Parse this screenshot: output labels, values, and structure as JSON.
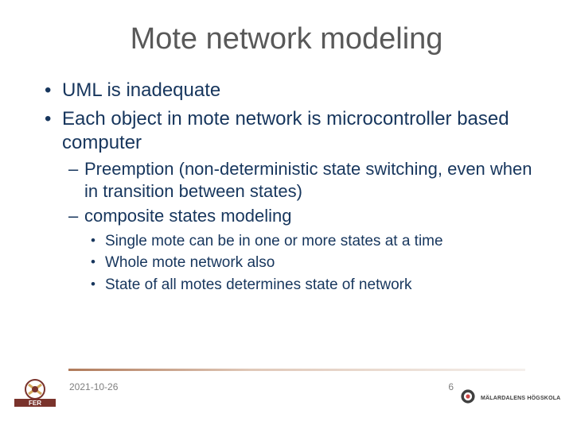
{
  "title": "Mote network modeling",
  "bullets": {
    "b1": "UML is inadequate",
    "b2": "Each object in mote network is microcontroller based computer",
    "sub1": "Preemption (non-deterministic state switching, even when in transition between states)",
    "sub2": "composite states modeling",
    "ssub1": "Single mote can be in one or more states at a time",
    "ssub2": "Whole mote network also",
    "ssub3": "State of all motes determines state of network"
  },
  "footer": {
    "date": "2021-10-26",
    "page": "6",
    "right_logo_text": "MÄLARDALENS HÖGSKOLA"
  }
}
